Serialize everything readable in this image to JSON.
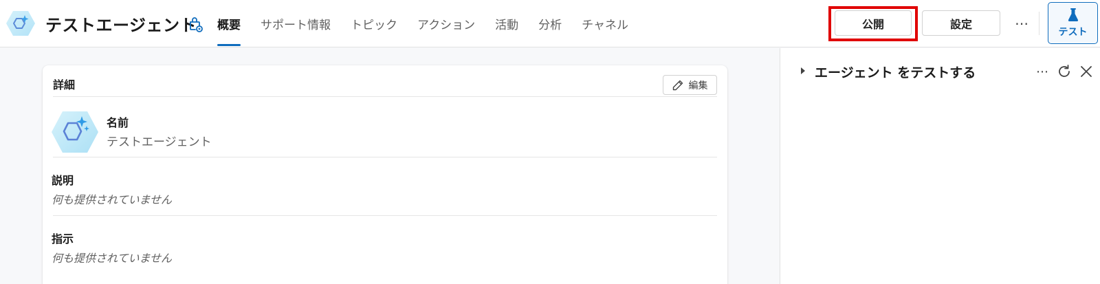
{
  "header": {
    "agent_name": "テストエージェント",
    "tabs": [
      {
        "label": "概要",
        "active": true
      },
      {
        "label": "サポート情報",
        "active": false
      },
      {
        "label": "トピック",
        "active": false
      },
      {
        "label": "アクション",
        "active": false
      },
      {
        "label": "活動",
        "active": false
      },
      {
        "label": "分析",
        "active": false
      },
      {
        "label": "チャネル",
        "active": false
      }
    ],
    "publish_label": "公開",
    "settings_label": "設定",
    "more_label": "⋯",
    "test_label": "テスト",
    "icons": [
      "agent-logo-icon",
      "agent-share-icon",
      "beaker-icon"
    ]
  },
  "details": {
    "title": "詳細",
    "edit_label": "編集",
    "name_label": "名前",
    "name_value": "テストエージェント",
    "description_label": "説明",
    "description_value": "何も提供されていません",
    "instructions_label": "指示",
    "instructions_value": "何も提供されていません"
  },
  "test_panel": {
    "title": "エージェント をテストする",
    "more_label": "⋯",
    "icons": [
      "caret-right-icon",
      "refresh-icon",
      "close-icon"
    ]
  },
  "colors": {
    "accent": "#0f6cbd",
    "highlight": "#e00000",
    "background": "#f7f8fa"
  }
}
